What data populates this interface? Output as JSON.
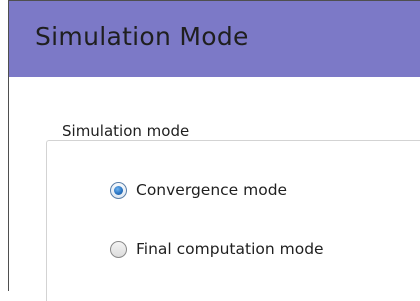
{
  "window": {
    "title": "Simulation Mode"
  },
  "group": {
    "label": "Simulation mode",
    "options": [
      {
        "label": "Convergence mode",
        "checked": true
      },
      {
        "label": "Final computation mode",
        "checked": false
      }
    ]
  },
  "colors": {
    "title_bar": "#7c79c7",
    "radio_selected": "#2a75c4"
  }
}
